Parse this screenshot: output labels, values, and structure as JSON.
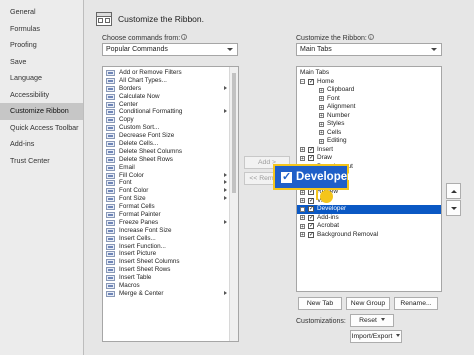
{
  "sidebar": {
    "items": [
      {
        "label": "General"
      },
      {
        "label": "Formulas"
      },
      {
        "label": "Proofing"
      },
      {
        "label": "Save"
      },
      {
        "label": "Language"
      },
      {
        "label": "Accessibility"
      },
      {
        "label": "Customize Ribbon",
        "active": true
      },
      {
        "label": "Quick Access Toolbar"
      },
      {
        "label": "Add-ins"
      },
      {
        "label": "Trust Center"
      }
    ]
  },
  "header": {
    "title": "Customize the Ribbon.",
    "icon": "ribbon-icon"
  },
  "left_panel": {
    "label": "Choose commands from:",
    "select_value": "Popular Commands",
    "commands": [
      {
        "label": "Add or Remove Filters",
        "icon": "filter-icon"
      },
      {
        "label": "All Chart Types...",
        "icon": "chart-icon"
      },
      {
        "label": "Borders",
        "icon": "borders-icon",
        "submenu": true
      },
      {
        "label": "Calculate Now",
        "icon": "calculator-icon"
      },
      {
        "label": "Center",
        "icon": "center-icon"
      },
      {
        "label": "Conditional Formatting",
        "icon": "conditional-format-icon",
        "submenu": true
      },
      {
        "label": "Copy",
        "icon": "copy-icon"
      },
      {
        "label": "Custom Sort...",
        "icon": "sort-icon"
      },
      {
        "label": "Decrease Font Size",
        "icon": "font-decrease-icon"
      },
      {
        "label": "Delete Cells...",
        "icon": "delete-cells-icon"
      },
      {
        "label": "Delete Sheet Columns",
        "icon": "delete-columns-icon"
      },
      {
        "label": "Delete Sheet Rows",
        "icon": "delete-rows-icon"
      },
      {
        "label": "Email",
        "icon": "email-icon"
      },
      {
        "label": "Fill Color",
        "icon": "fill-color-icon",
        "submenu": true
      },
      {
        "label": "Font",
        "icon": "font-icon",
        "submenu": true
      },
      {
        "label": "Font Color",
        "icon": "font-color-icon",
        "submenu": true
      },
      {
        "label": "Font Size",
        "icon": "font-size-icon",
        "submenu": true
      },
      {
        "label": "Format Cells",
        "icon": "format-cells-icon"
      },
      {
        "label": "Format Painter",
        "icon": "format-painter-icon"
      },
      {
        "label": "Freeze Panes",
        "icon": "freeze-panes-icon",
        "submenu": true
      },
      {
        "label": "Increase Font Size",
        "icon": "font-increase-icon"
      },
      {
        "label": "Insert Cells...",
        "icon": "insert-cells-icon"
      },
      {
        "label": "Insert Function...",
        "icon": "function-icon"
      },
      {
        "label": "Insert Picture",
        "icon": "picture-icon"
      },
      {
        "label": "Insert Sheet Columns",
        "icon": "insert-columns-icon"
      },
      {
        "label": "Insert Sheet Rows",
        "icon": "insert-rows-icon"
      },
      {
        "label": "Insert Table",
        "icon": "table-icon"
      },
      {
        "label": "Macros",
        "icon": "macros-icon"
      },
      {
        "label": "Merge & Center",
        "icon": "merge-icon",
        "submenu": true
      }
    ]
  },
  "middle": {
    "add_label": "Add >",
    "remove_label": "<< Remove"
  },
  "right_panel": {
    "label": "Customize the Ribbon:",
    "select_value": "Main Tabs",
    "tree": [
      {
        "label": "Main Tabs",
        "level": 0,
        "header": true
      },
      {
        "label": "Home",
        "level": 1,
        "expander": "−",
        "checked": true
      },
      {
        "label": "Clipboard",
        "level": 2,
        "expander": "+"
      },
      {
        "label": "Font",
        "level": 2,
        "expander": "+"
      },
      {
        "label": "Alignment",
        "level": 2,
        "expander": "+"
      },
      {
        "label": "Number",
        "level": 2,
        "expander": "+"
      },
      {
        "label": "Styles",
        "level": 2,
        "expander": "+"
      },
      {
        "label": "Cells",
        "level": 2,
        "expander": "+"
      },
      {
        "label": "Editing",
        "level": 2,
        "expander": "+"
      },
      {
        "label": "Insert",
        "level": 1,
        "expander": "+",
        "checked": true
      },
      {
        "label": "Draw",
        "level": 1,
        "expander": "+",
        "checked": true
      },
      {
        "label": "Page Layout",
        "level": 1,
        "expander": "+",
        "checked": true
      },
      {
        "label": "Formulas",
        "level": 1,
        "expander": "+",
        "checked": true
      },
      {
        "label": "Data",
        "level": 1,
        "expander": "+",
        "checked": true
      },
      {
        "label": "Review",
        "level": 1,
        "expander": "+",
        "checked": true
      },
      {
        "label": "View",
        "level": 1,
        "expander": "+",
        "checked": true
      },
      {
        "label": "Developer",
        "level": 1,
        "expander": "+",
        "checked": true,
        "selected": true
      },
      {
        "label": "Add-ins",
        "level": 1,
        "expander": "+",
        "checked": true
      },
      {
        "label": "Acrobat",
        "level": 1,
        "expander": "+",
        "checked": true
      },
      {
        "label": "Background Removal",
        "level": 1,
        "expander": "+",
        "checked": true
      }
    ],
    "new_tab_label": "New Tab",
    "new_group_label": "New Group",
    "rename_label": "Rename...",
    "customizations_label": "Customizations:",
    "reset_label": "Reset",
    "import_export_label": "Import/Export"
  },
  "callout": {
    "label": "Developer",
    "color": "#1f5fc8",
    "border_color": "#f4c51b"
  }
}
